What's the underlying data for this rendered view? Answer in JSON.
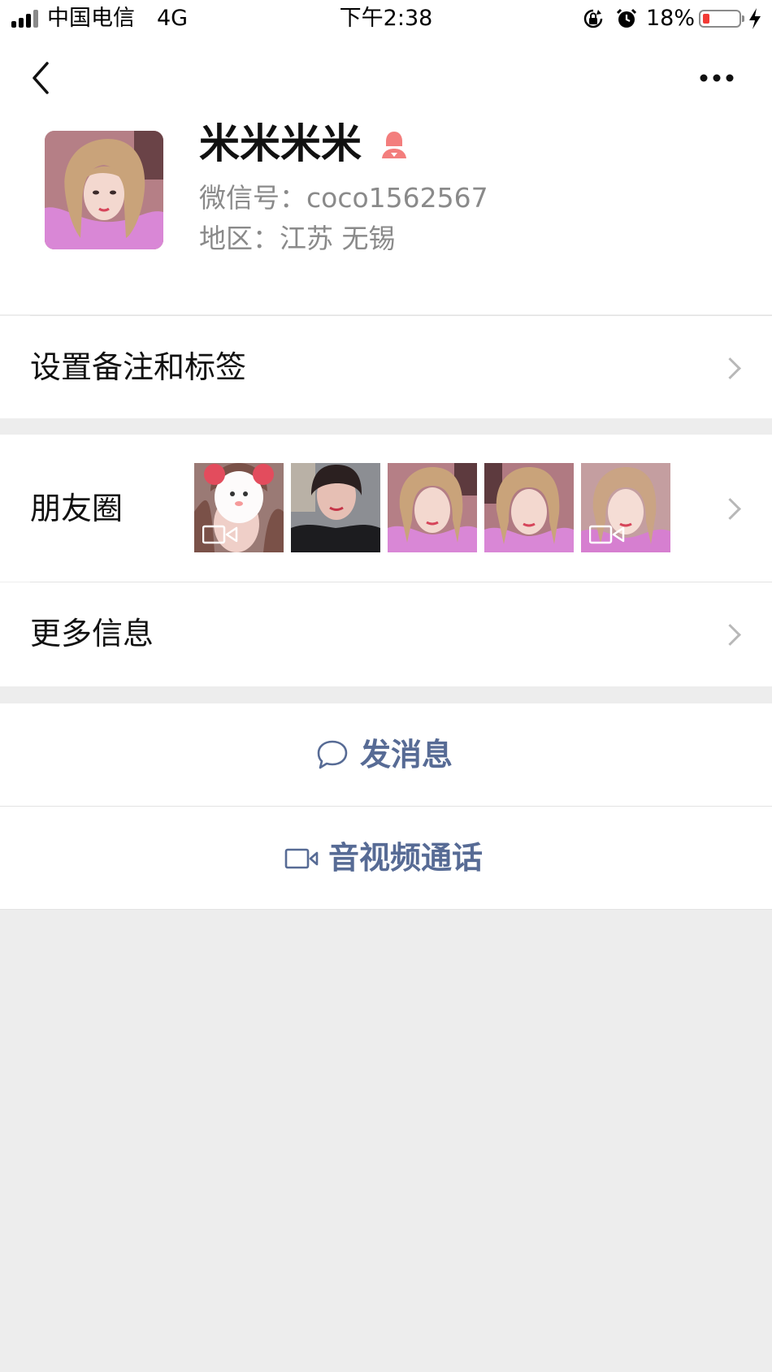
{
  "status_bar": {
    "carrier": "中国电信",
    "network": "4G",
    "time": "下午2:38",
    "battery_percent": "18%",
    "battery_level": 0.18,
    "battery_color": "#f23a35"
  },
  "profile": {
    "nickname": "米米米米",
    "gender_icon": "female-icon",
    "wechat_id_label": "微信号：",
    "wechat_id": "coco1562567",
    "region_label": "地区：",
    "region": "江苏 无锡"
  },
  "menu": {
    "remark_tags": "设置备注和标签",
    "moments": "朋友圈",
    "more_info": "更多信息"
  },
  "moments_thumbs": [
    {
      "has_video": true
    },
    {
      "has_video": false
    },
    {
      "has_video": false
    },
    {
      "has_video": false
    },
    {
      "has_video": true
    }
  ],
  "actions": {
    "send_message": "发消息",
    "voice_video_call": "音视频通话"
  },
  "colors": {
    "link_blue": "#576b95",
    "gender_female": "#f37e7d",
    "page_bg": "#ededed"
  }
}
